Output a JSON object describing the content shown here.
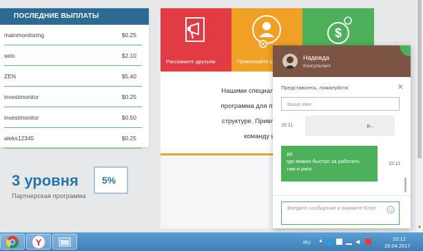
{
  "payouts": {
    "title": "ПОСЛЕДНИЕ ВЫПЛАТЫ",
    "rows": [
      {
        "name": "mainmonitoring",
        "amount": "$0.25"
      },
      {
        "name": "selo",
        "amount": "$2.10"
      },
      {
        "name": "ZEN",
        "amount": "$5.40"
      },
      {
        "name": "investmonitor",
        "amount": "$0.25"
      },
      {
        "name": "investmonitor",
        "amount": "$0.50"
      },
      {
        "name": "aleks12345",
        "amount": "$0.25"
      }
    ]
  },
  "promo": {
    "tiles": [
      {
        "label": "Расскажите друзьям",
        "icon": "megaphone-icon",
        "color": "#e23b44"
      },
      {
        "label": "Привлекайте рефералов",
        "icon": "add-user-icon",
        "color": "#f0a024"
      },
      {
        "label": "",
        "icon": "money-icon",
        "color": "#4db05a"
      }
    ],
    "text_lines": [
      "Нашими специалистами была",
      "программа для привлечение и",
      "структуре. Привлекайте рефе",
      "команду и зара"
    ],
    "levels_title": "3 уровня",
    "levels_sub": "Партнерская программа",
    "percent": "5%"
  },
  "chat": {
    "agent_name": "Надежда",
    "agent_role": "Консультант",
    "intro_label": "Представьтесь, пожалуйста:",
    "name_placeholder": "Ваше имя",
    "msg_in_time": "15:11",
    "msg_in_text": "р...",
    "msg_out_lines": [
      "да",
      "где можно быстро за работать",
      "там и риск"
    ],
    "msg_out_time": "15:11",
    "compose_placeholder": "Введите сообщение и нажмите Enter",
    "header_color": "#7b5443",
    "accent_color": "#4db05a"
  },
  "taskbar": {
    "language": "RU",
    "time": "15:12",
    "date": "29.04.2017",
    "apps": [
      "chrome-icon",
      "yandex-browser-icon",
      "file-manager-icon"
    ]
  }
}
